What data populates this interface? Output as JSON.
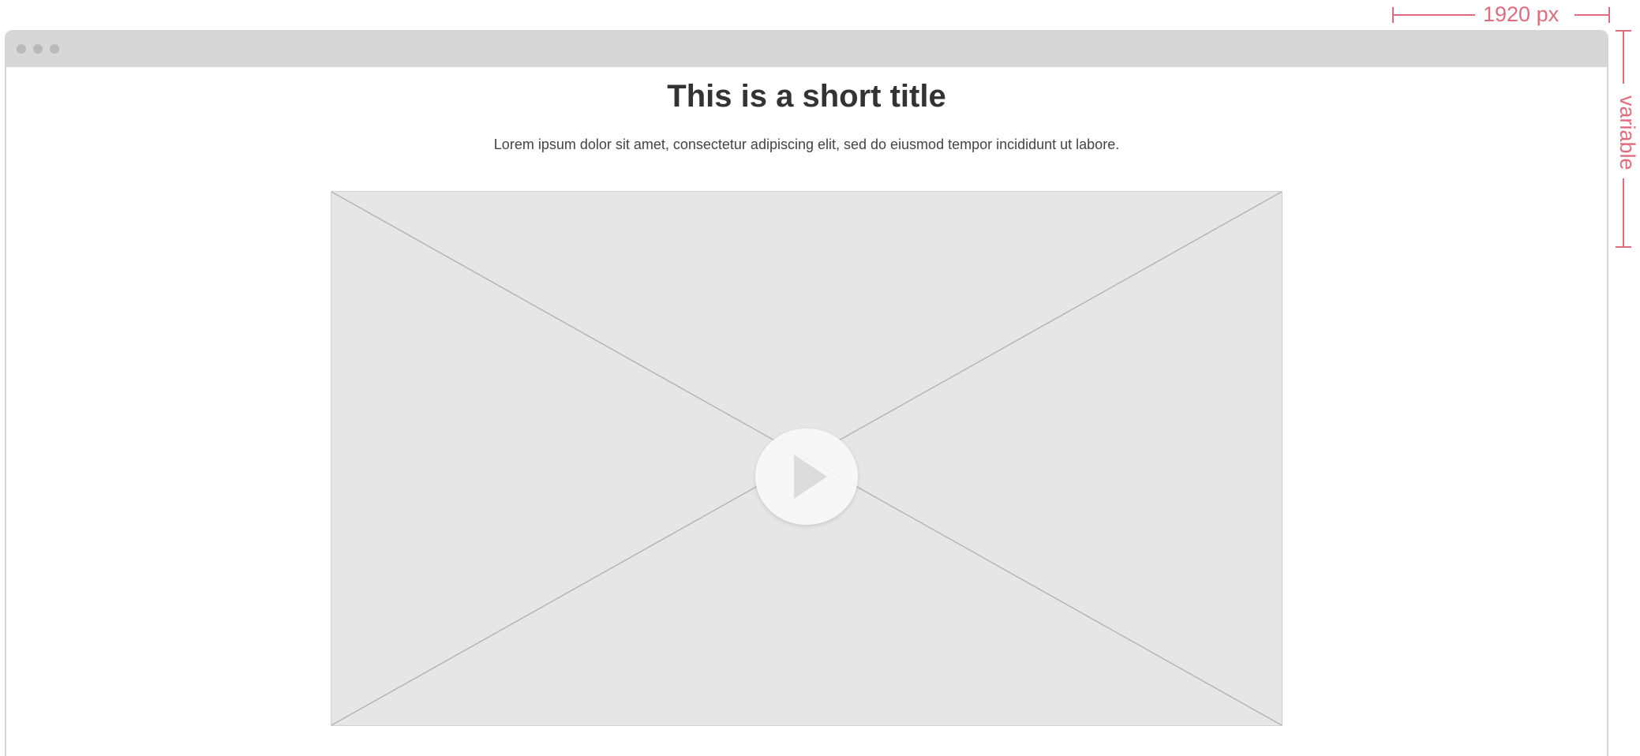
{
  "annotations": {
    "width_label": "1920 px",
    "height_label": "variable",
    "color": "#e06b7d"
  },
  "page": {
    "title": "This is a short title",
    "subtitle": "Lorem ipsum dolor sit amet, consectetur adipiscing elit, sed do eiusmod tempor incididunt ut labore."
  },
  "video": {
    "play_icon": "play-icon"
  }
}
